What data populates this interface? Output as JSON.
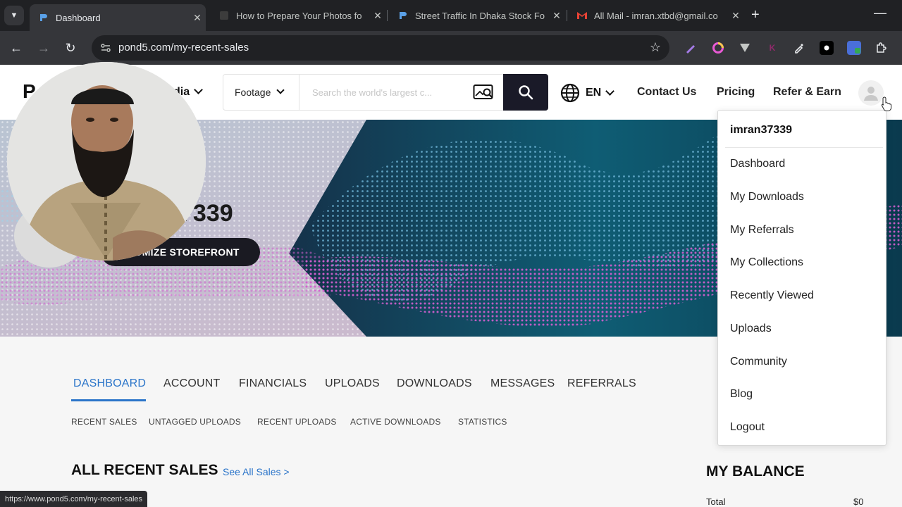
{
  "browser": {
    "tabs": [
      {
        "title": "Dashboard",
        "active": true
      },
      {
        "title": "How to Prepare Your Photos fo",
        "active": false
      },
      {
        "title": "Street Traffic In Dhaka Stock Fo",
        "active": false
      },
      {
        "title": "All Mail - imran.xtbd@gmail.co",
        "active": false
      }
    ],
    "url": "pond5.com/my-recent-sales",
    "status_url": "https://www.pond5.com/my-recent-sales"
  },
  "header": {
    "logo_letter": "P",
    "media_label": "dia",
    "search_type": "Footage",
    "search_placeholder": "Search the world's largest c...",
    "language": "EN",
    "nav": [
      "Contact Us",
      "Pricing",
      "Refer & Earn"
    ]
  },
  "hero": {
    "username_partial": "7339",
    "customize_label": "STOMIZE STOREFRONT"
  },
  "account_tabs": [
    "DASHBOARD",
    "ACCOUNT",
    "FINANCIALS",
    "UPLOADS",
    "DOWNLOADS",
    "MESSAGES",
    "REFERRALS"
  ],
  "sub_tabs": [
    "RECENT SALES",
    "UNTAGGED UPLOADS",
    "RECENT UPLOADS",
    "ACTIVE DOWNLOADS",
    "STATISTICS"
  ],
  "sales": {
    "title": "ALL RECENT SALES",
    "see_all": "See All Sales >"
  },
  "balance": {
    "title": "MY BALANCE",
    "total_label": "Total",
    "total_value": "$0"
  },
  "dropdown": {
    "username": "imran37339",
    "items": [
      "Dashboard",
      "My Downloads",
      "My Referrals",
      "My Collections",
      "Recently Viewed",
      "Uploads",
      "Community",
      "Blog",
      "Logout"
    ]
  },
  "colors": {
    "accent": "#2a74c9",
    "search_button": "#1a1a28",
    "browser_dark": "#202124"
  }
}
